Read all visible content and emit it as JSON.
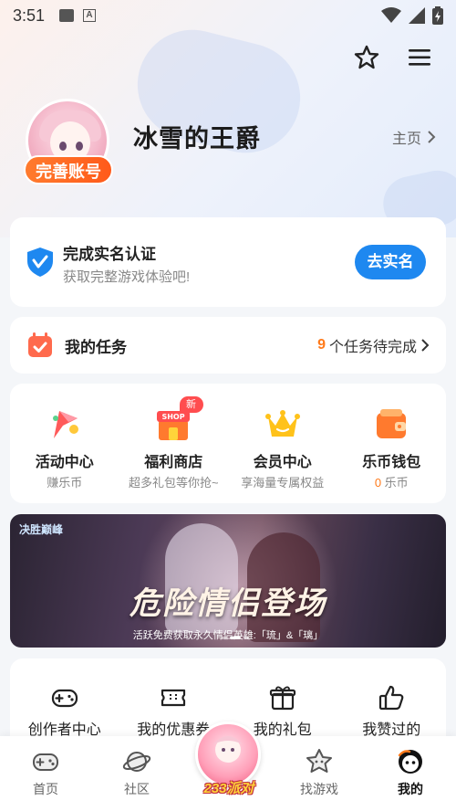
{
  "status_bar": {
    "time": "3:51"
  },
  "profile": {
    "username": "冰雪的王爵",
    "complete_account_label": "完善账号",
    "homepage_label": "主页"
  },
  "verify": {
    "title": "完成实名认证",
    "subtitle": "获取完整游戏体验吧!",
    "button_label": "去实名"
  },
  "tasks": {
    "label": "我的任务",
    "pending_count": "9",
    "pending_suffix": "个任务待完成"
  },
  "features": [
    {
      "label": "活动中心",
      "sub": "赚乐币",
      "icon": "activity-flag-icon"
    },
    {
      "label": "福利商店",
      "sub": "超多礼包等你抢~",
      "icon": "shop-icon",
      "badge": "新"
    },
    {
      "label": "会员中心",
      "sub": "享海量专属权益",
      "icon": "crown-icon"
    },
    {
      "label": "乐币钱包",
      "sub_number": "0",
      "sub_suffix": "乐币",
      "icon": "wallet-icon"
    }
  ],
  "banner": {
    "brand": "决胜巅峰",
    "title": "危险情侣登场",
    "subtitle": "活跃免费获取永久情侣英雄:「琉」&「璃」"
  },
  "tools": [
    {
      "label": "创作者中心",
      "icon": "gamepad-icon"
    },
    {
      "label": "我的优惠券",
      "icon": "ticket-icon"
    },
    {
      "label": "我的礼包",
      "icon": "gift-icon"
    },
    {
      "label": "我赞过的",
      "icon": "thumbs-up-icon"
    }
  ],
  "bottom_nav": [
    {
      "label": "首页",
      "icon": "home-gamepad-icon"
    },
    {
      "label": "社区",
      "icon": "planet-icon"
    },
    {
      "label": "233派对",
      "icon": "party-icon"
    },
    {
      "label": "找游戏",
      "icon": "star-face-icon"
    },
    {
      "label": "我的",
      "icon": "profile-face-icon",
      "active": true
    }
  ],
  "colors": {
    "accent_blue": "#1e88f0",
    "accent_orange": "#ff7a1a",
    "badge_red": "#ff4d4f"
  }
}
